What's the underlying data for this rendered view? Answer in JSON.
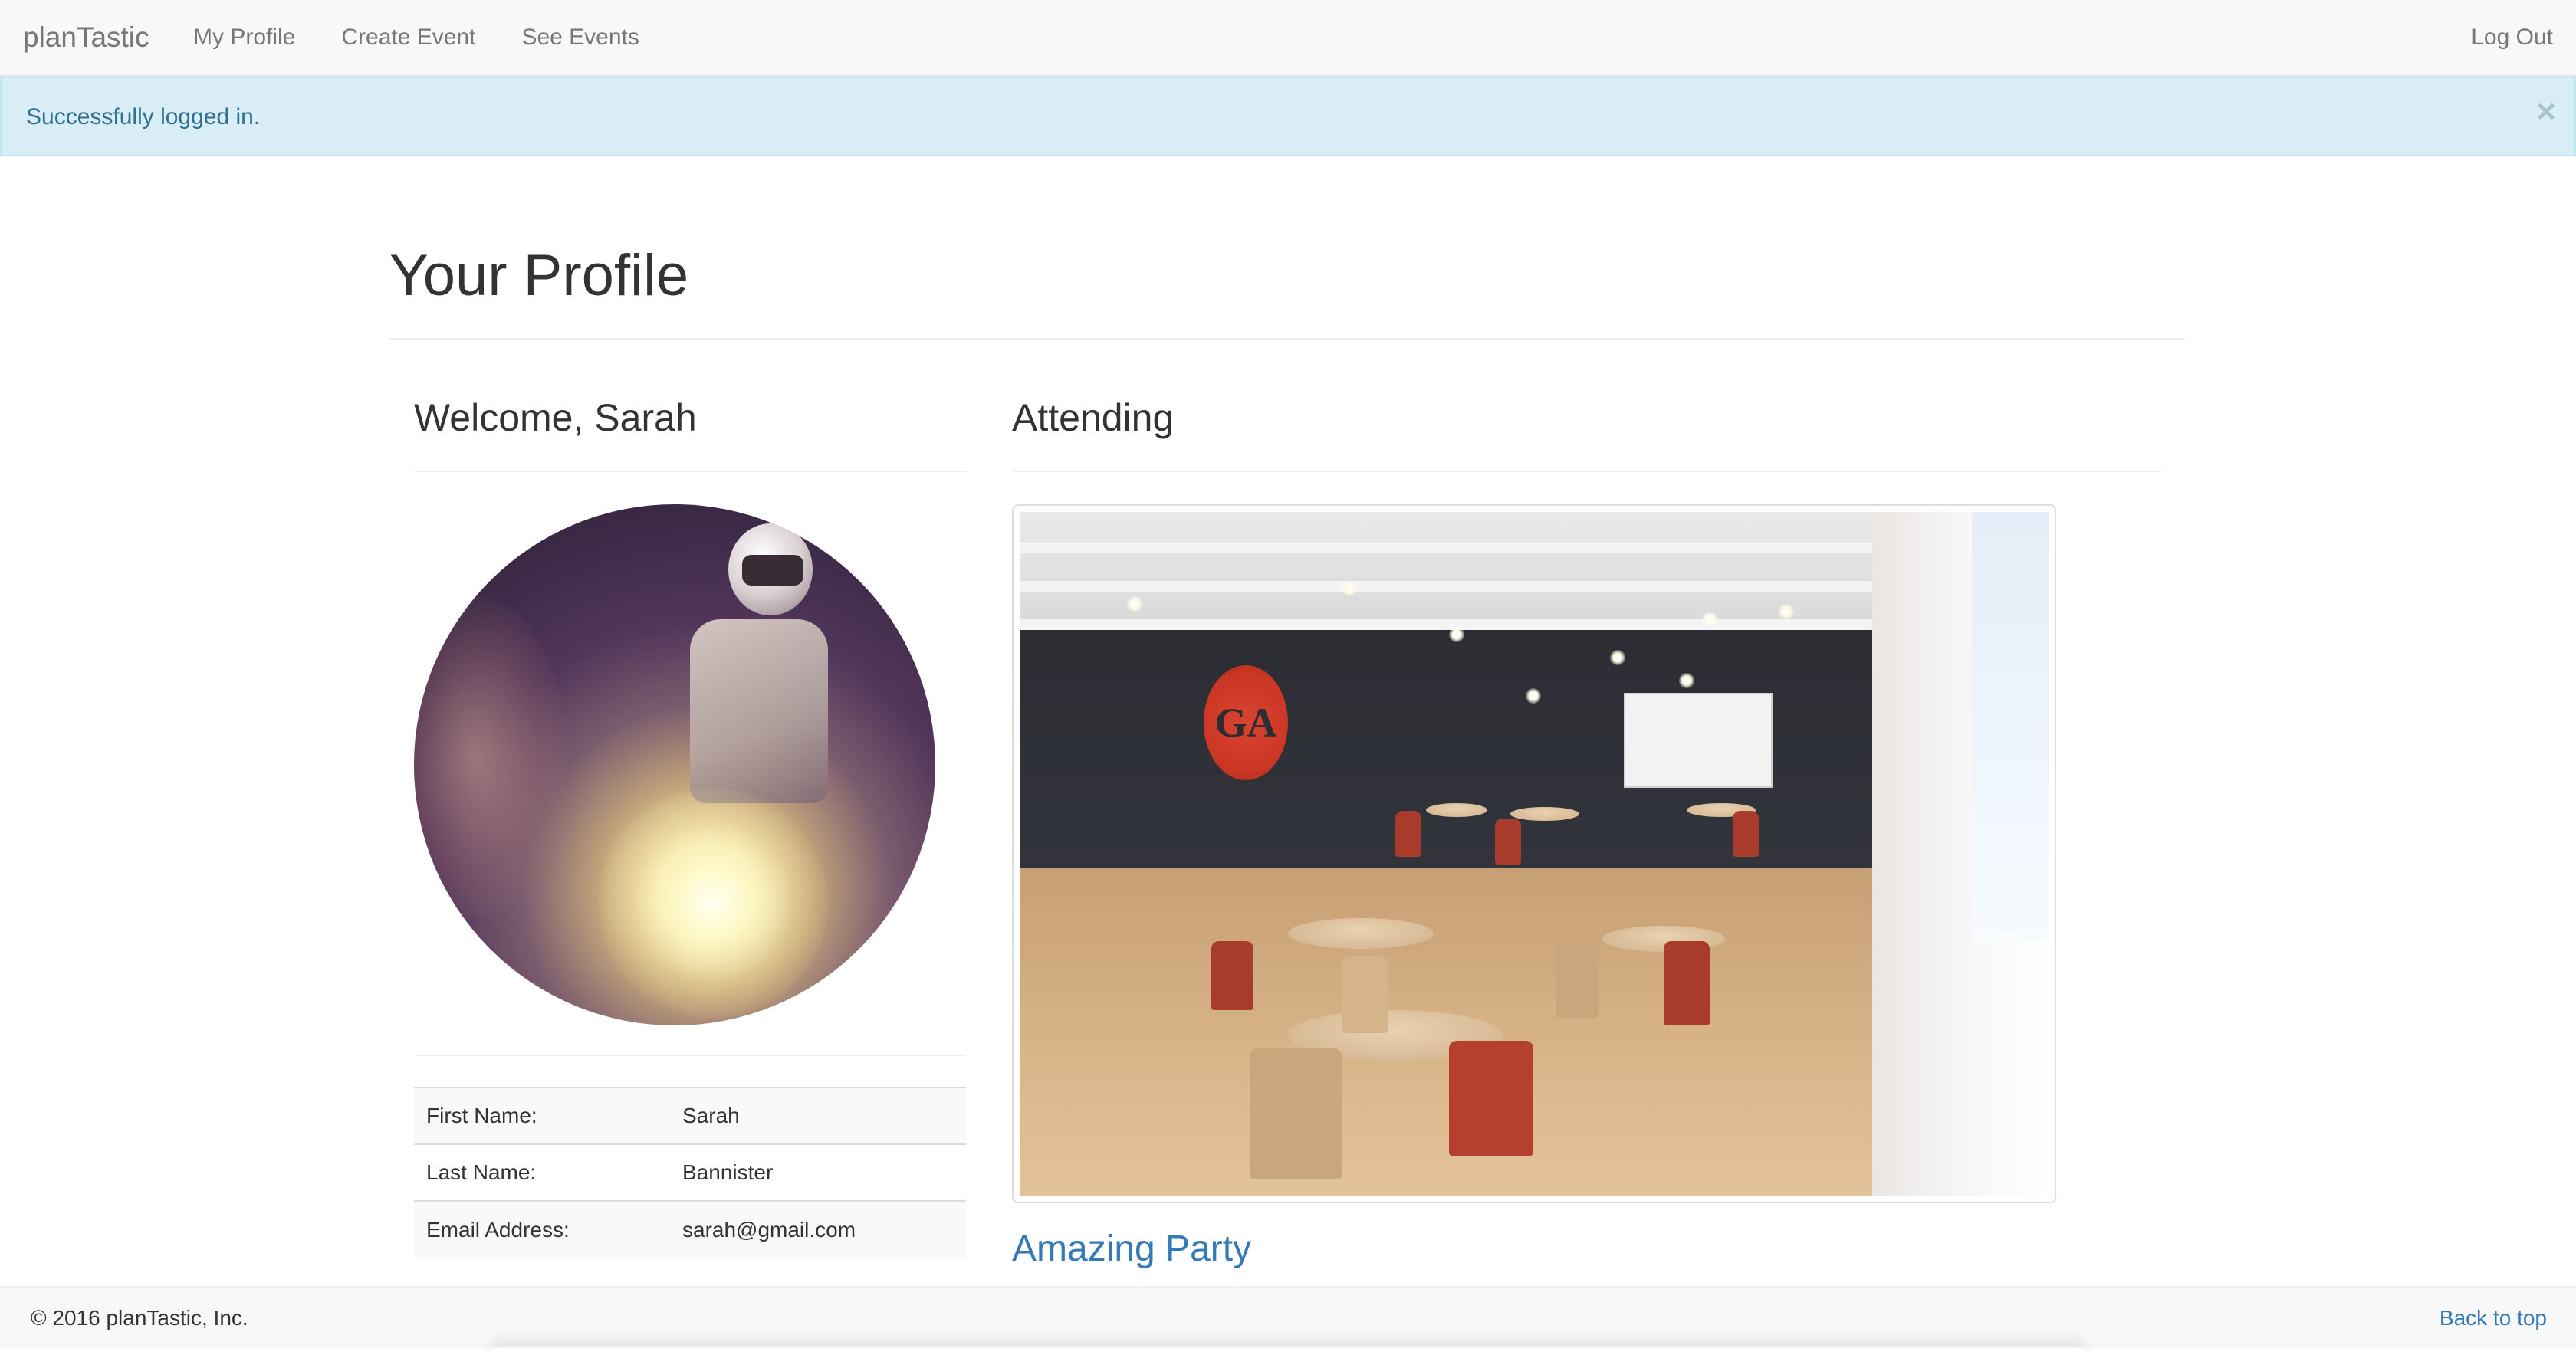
{
  "navbar": {
    "brand": "planTastic",
    "links": [
      {
        "label": "My Profile"
      },
      {
        "label": "Create Event"
      },
      {
        "label": "See Events"
      }
    ],
    "logout_label": "Log Out"
  },
  "alert": {
    "message": "Successfully logged in.",
    "close_glyph": "×",
    "color": "#31708f",
    "background": "#d9edf7"
  },
  "page": {
    "title": "Your Profile"
  },
  "profile": {
    "welcome": "Welcome, Sarah",
    "rows": [
      {
        "label": "First Name:",
        "value": "Sarah"
      },
      {
        "label": "Last Name:",
        "value": "Bannister"
      },
      {
        "label": "Email Address:",
        "value": "sarah@gmail.com"
      }
    ]
  },
  "attending": {
    "heading": "Attending",
    "events": [
      {
        "title": "Amazing Party",
        "logo_text": "GA"
      }
    ]
  },
  "footer": {
    "copyright": "© 2016 planTastic, Inc.",
    "back_to_top": "Back to top"
  },
  "colors": {
    "link": "#337ab7",
    "nav_text": "#777777",
    "navbar_bg": "#f8f8f8"
  }
}
